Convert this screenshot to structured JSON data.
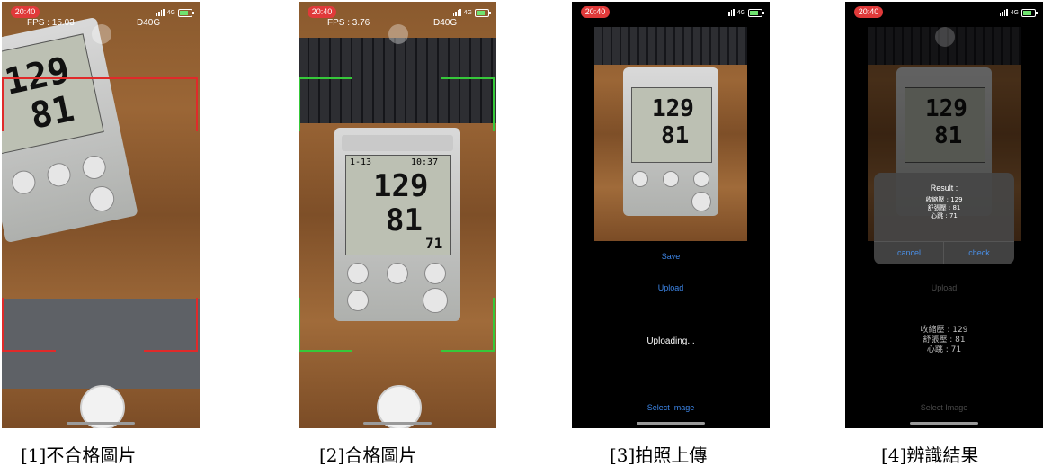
{
  "status_time": "20:40",
  "network": "4G",
  "screens": [
    {
      "fps": "FPS : 15.03",
      "device_label": "D40G",
      "caption": "[1]不合格圖片",
      "frame_color": "#e02a2a"
    },
    {
      "fps": "FPS : 3.76",
      "device_label": "D40G",
      "caption": "[2]合格圖片",
      "frame_color": "#36c83a"
    },
    {
      "caption": "[3]拍照上傳",
      "save_label": "Save",
      "upload_label": "Upload",
      "uploading_label": "Uploading...",
      "select_label": "Select Image"
    },
    {
      "caption": "[4]辨識結果",
      "dialog_title": "Result :",
      "dialog_lines": [
        "收縮壓 : 129",
        "舒張壓 : 81",
        "心跳 : 71"
      ],
      "cancel_label": "cancel",
      "check_label": "check",
      "upload_label": "Upload",
      "result_lines": [
        "收縮壓 : 129",
        "舒張壓 : 81",
        "心跳 : 71"
      ],
      "select_label": "Select Image"
    }
  ],
  "lcd": {
    "date": "1-13",
    "time": "10:37",
    "sys": "129",
    "dia": "81",
    "pulse": "71"
  }
}
